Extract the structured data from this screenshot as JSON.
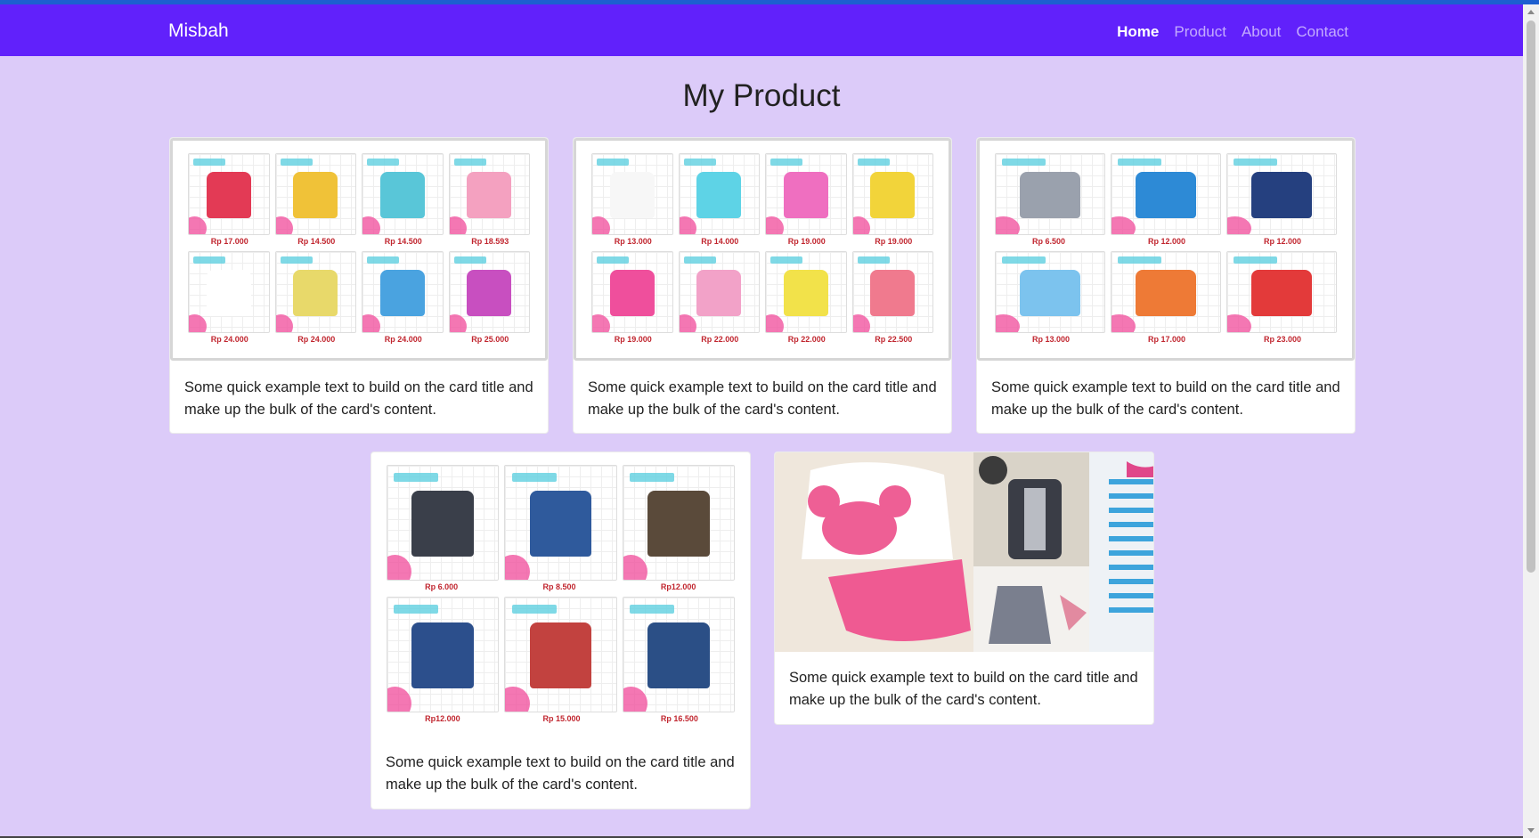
{
  "navbar": {
    "brand": "Misbah",
    "links": [
      "Home",
      "Product",
      "About",
      "Contact"
    ],
    "active": "Home",
    "color": "#6121fb"
  },
  "page": {
    "title": "My Product",
    "background": "#dccbf9"
  },
  "cards": [
    {
      "text": "Some quick example text to build on the card title and make up the bulk of the card's content.",
      "prices": [
        "Rp 17.000",
        "Rp 14.500",
        "Rp 14.500",
        "Rp 18.593",
        "Rp 24.000",
        "Rp 24.000",
        "Rp 24.000",
        "Rp 25.000"
      ]
    },
    {
      "text": "Some quick example text to build on the card title and make up the bulk of the card's content.",
      "prices": [
        "Rp 13.000",
        "Rp 14.000",
        "Rp 19.000",
        "Rp 19.000",
        "Rp 19.000",
        "Rp 22.000",
        "Rp 22.000",
        "Rp 22.500"
      ]
    },
    {
      "text": "Some quick example text to build on the card title and make up the bulk of the card's content.",
      "prices": [
        "Rp 6.500",
        "Rp 12.000",
        "Rp 12.000",
        "Rp 13.000",
        "Rp 17.000",
        "Rp 23.000"
      ]
    },
    {
      "text": "Some quick example text to build on the card title and make up the bulk of the card's content.",
      "prices": [
        "Rp 6.000",
        "Rp 8.500",
        "Rp12.000",
        "Rp12.000",
        "Rp 15.000",
        "Rp 16.500"
      ]
    },
    {
      "text": "Some quick example text to build on the card title and make up the bulk of the card's content."
    }
  ]
}
